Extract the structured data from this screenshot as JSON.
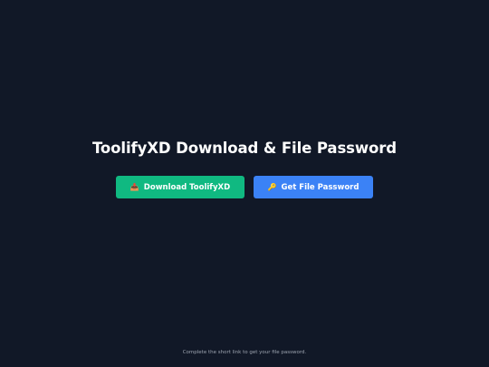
{
  "page": {
    "title": "ToolifyXD Download & File Password"
  },
  "buttons": {
    "download": {
      "icon": "inbox-tray-icon",
      "glyph": "📥",
      "label": "Download ToolifyXD",
      "color": "#10b981"
    },
    "password": {
      "icon": "key-icon",
      "glyph": "🔑",
      "label": "Get File Password",
      "color": "#3b82f6"
    }
  },
  "footer": {
    "note": "Complete the short link to get your file password."
  },
  "colors": {
    "background": "#111827",
    "text": "#ffffff",
    "muted": "#9ca3af"
  }
}
